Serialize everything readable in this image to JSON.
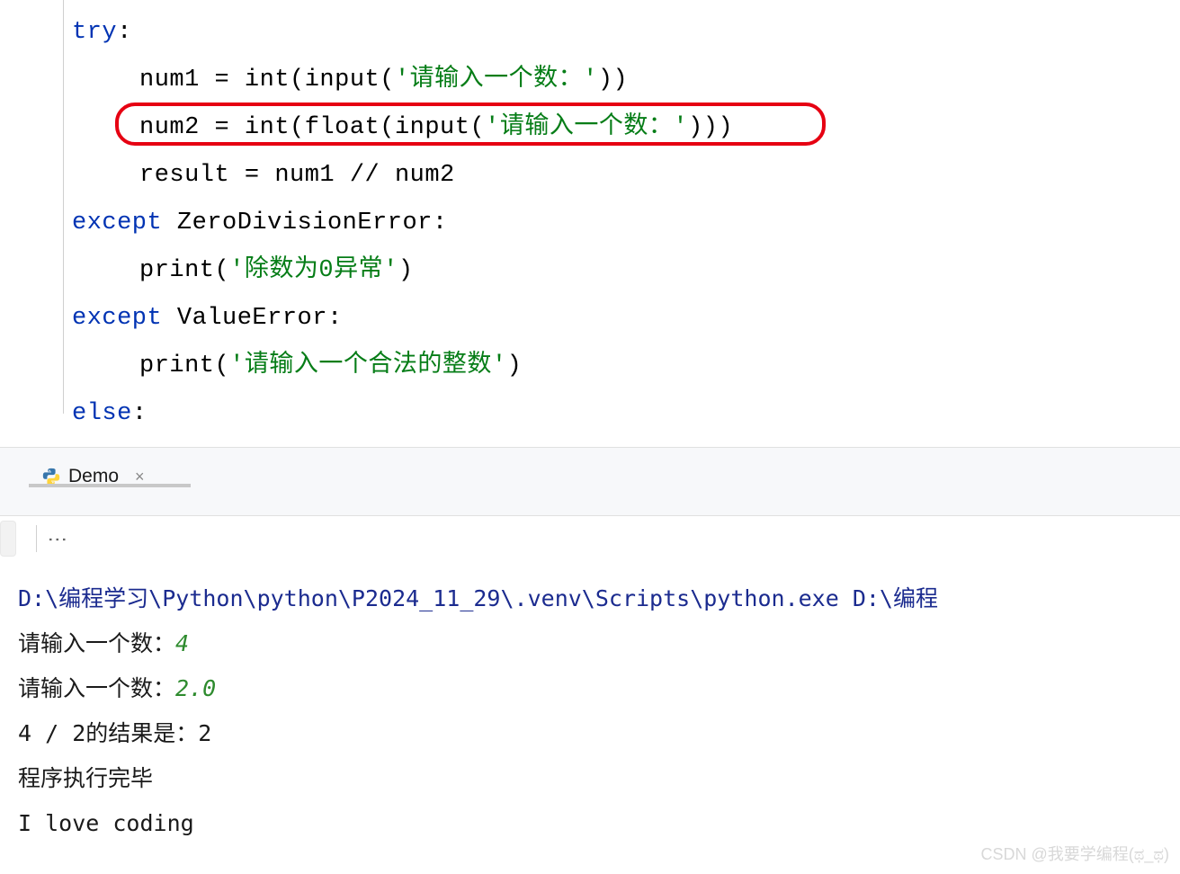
{
  "code": {
    "line1": {
      "kw": "try",
      "rest": ":"
    },
    "line2": {
      "var": "num1 = ",
      "fn1": "int",
      "p1": "(",
      "fn2": "input",
      "p2": "(",
      "str": "'请输入一个数：'",
      "p3": "))"
    },
    "line3": {
      "var": "num2 = ",
      "fn1": "int",
      "p1": "(",
      "fn2": "float",
      "p2": "(",
      "fn3": "input",
      "p3": "(",
      "str": "'请输入一个数：'",
      "p4": ")))"
    },
    "line4": {
      "text": "result = num1 // num2"
    },
    "line5": {
      "kw": "except",
      "sp": " ",
      "cls": "ZeroDivisionError",
      "rest": ":"
    },
    "line6": {
      "fn": "print",
      "p1": "(",
      "str": "'除数为0异常'",
      "p2": ")"
    },
    "line7": {
      "kw": "except",
      "sp": " ",
      "cls": "ValueError",
      "rest": ":"
    },
    "line8": {
      "fn": "print",
      "p1": "(",
      "str": "'请输入一个合法的整数'",
      "p2": ")"
    },
    "line9": {
      "kw": "else",
      "rest": ":"
    }
  },
  "tab": {
    "name": "Demo",
    "close": "×"
  },
  "toolbar": {
    "dots": "⋮"
  },
  "console": {
    "path": "D:\\编程学习\\Python\\python\\P2024_11_29\\.venv\\Scripts\\python.exe D:\\编程",
    "prompt1_label": "请输入一个数：",
    "prompt1_value": "4",
    "prompt2_label": "请输入一个数：",
    "prompt2_value": "2.0",
    "result": "4 / 2的结果是：2",
    "finish": "程序执行完毕",
    "love": "I love coding"
  },
  "watermark": "CSDN @我要学编程(ಥ_ಥ)"
}
